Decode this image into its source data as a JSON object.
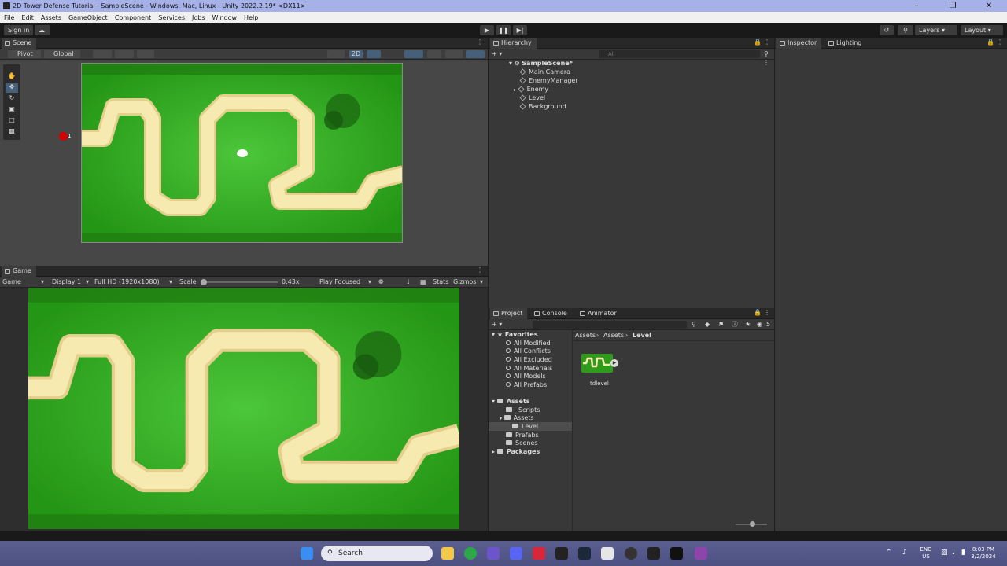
{
  "window": {
    "title": "2D Tower Defense Tutorial - SampleScene - Windows, Mac, Linux - Unity 2022.2.19* <DX11>"
  },
  "menu": [
    "File",
    "Edit",
    "Assets",
    "GameObject",
    "Component",
    "Services",
    "Jobs",
    "Window",
    "Help"
  ],
  "toolbar": {
    "sign_in": "Sign in",
    "layers": "Layers",
    "layout": "Layout"
  },
  "scene": {
    "tab": "Scene",
    "pivot": "Pivot",
    "global": "Global",
    "mode2d": "2D",
    "marker": "1"
  },
  "game": {
    "tab": "Game",
    "view": "Game",
    "display": "Display 1",
    "resolution": "Full HD (1920x1080)",
    "scale_label": "Scale",
    "scale_value": "0.43x",
    "play_focused": "Play Focused",
    "stats": "Stats",
    "gizmos": "Gizmos"
  },
  "hierarchy": {
    "tab": "Hierarchy",
    "search_placeholder": "All",
    "scene": "SampleScene*",
    "items": [
      "Main Camera",
      "EnemyManager",
      "Enemy",
      "Level",
      "Background"
    ]
  },
  "project": {
    "tabs": [
      "Project",
      "Console",
      "Animator"
    ],
    "hidden_count": "5",
    "breadcrumb": [
      "Assets",
      "Assets",
      "Level"
    ],
    "favorites_label": "Favorites",
    "favorites": [
      "All Modified",
      "All Conflicts",
      "All Excluded",
      "All Materials",
      "All Models",
      "All Prefabs"
    ],
    "assets_label": "Assets",
    "assets_children": [
      "_Scripts",
      "Assets",
      "Level",
      "Prefabs",
      "Scenes"
    ],
    "packages_label": "Packages",
    "asset_file": "tdlevel"
  },
  "inspector": {
    "tabs": [
      "Inspector",
      "Lighting"
    ]
  },
  "taskbar": {
    "search": "Search",
    "lang": "ENG",
    "region": "US",
    "time": "8:03 PM",
    "date": "3/2/2024"
  }
}
